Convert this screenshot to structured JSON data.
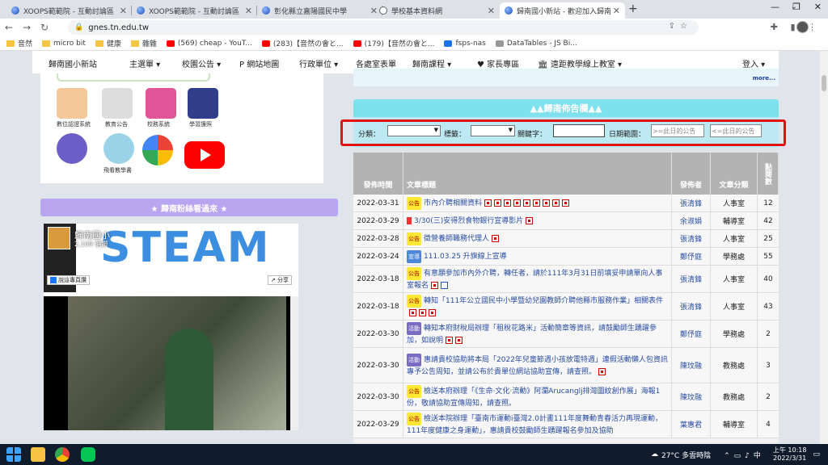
{
  "browser": {
    "tabs": [
      {
        "label": "XOOPS範範院 - 互動討論區",
        "active": false
      },
      {
        "label": "XOOPS範範院 - 互動討論區",
        "active": false
      },
      {
        "label": "彰化縣立嘉陽國民中學",
        "active": false
      },
      {
        "label": "學校基本資料網",
        "active": false
      },
      {
        "label": "歸南國小新站 - 歡迎加入歸南大家庭",
        "active": true
      }
    ],
    "url": "gnes.tn.edu.tw",
    "bookmarks": [
      {
        "label": "音然",
        "icon": "folder"
      },
      {
        "label": "micro bit",
        "icon": "folder"
      },
      {
        "label": "健康",
        "icon": "folder"
      },
      {
        "label": "雜雜",
        "icon": "folder"
      },
      {
        "label": "(569) cheap - YouT...",
        "icon": "yt"
      },
      {
        "label": "(283)【音然の會と...",
        "icon": "yt"
      },
      {
        "label": "(179)【音然の會と...",
        "icon": "yt"
      },
      {
        "label": "fsps-nas",
        "icon": "blue"
      },
      {
        "label": "DataTables - JS Bi...",
        "icon": "gray"
      }
    ]
  },
  "nav": {
    "site": "歸南國小新站",
    "items": [
      "主選單 ▾",
      "校園公告 ▾",
      "網站地圖",
      "行政單位 ▾",
      "各處室表單",
      "歸南課程 ▾",
      "家長專區",
      "遠距教學線上教室 ▾"
    ],
    "login": "登入 ▾"
  },
  "apps": [
    "數位認證系統",
    "教育公告",
    "校務系統",
    "學習護照",
    "飛看教學書"
  ],
  "fans": {
    "heading": "★ 歸南粉絲看過來 ★",
    "page_name": "歸南國小",
    "likes": "2,109 個讚",
    "like_btn": "說這專頁讚",
    "share_btn": "分享",
    "banner": "STEAM"
  },
  "announce": {
    "more": "more...",
    "heading": "▲▲歸南佈告欄▲▲",
    "filter": {
      "category_label": "分類：",
      "tag_label": "標籤：",
      "keyword_label": "關鍵字：",
      "date_label": "日期範圍：",
      "date_from_placeholder": ">=此日的公告",
      "date_to_placeholder": "<=此日的公告"
    },
    "columns": [
      "發佈時間",
      "文章標題",
      "發佈者",
      "文章分類",
      "點閱數"
    ],
    "rows": [
      {
        "date": "2022-03-31",
        "badge": "公告",
        "title": "市內介聘相關資料",
        "author": "張清鋒",
        "category": "人事室",
        "hits": "12"
      },
      {
        "date": "2022-03-29",
        "badge": "",
        "title": "3/30(三)安得烈食物銀行宣導影片",
        "author": "余淑娟",
        "category": "輔導室",
        "hits": "42"
      },
      {
        "date": "2022-03-28",
        "badge": "公告",
        "title": "徵營養師職務代理人",
        "author": "張清鋒",
        "category": "人事室",
        "hits": "25"
      },
      {
        "date": "2022-03-24",
        "badge": "宣導",
        "title": "111.03.25 升旗線上宣導",
        "author": "鄭伃庭",
        "category": "學務處",
        "hits": "55"
      },
      {
        "date": "2022-03-18",
        "badge": "公告",
        "title": "有意願參加市內外介聘，轉任者，請於111年3月31日前填妥申請單向人事室報名",
        "author": "張清鋒",
        "category": "人事室",
        "hits": "40"
      },
      {
        "date": "2022-03-18",
        "badge": "公告",
        "title": "轉知「111年公立國民中小學暨幼兒園教師介聘他縣市服務作業」相關表件",
        "author": "張清鋒",
        "category": "人事室",
        "hits": "43"
      },
      {
        "date": "2022-03-30",
        "badge": "活動",
        "title": "轉知本府財稅局辦理「租稅花路米」活動簡章等資訊，請鼓勵師生踴躍參加，如說明",
        "author": "鄭伃庭",
        "category": "學務處",
        "hits": "2"
      },
      {
        "date": "2022-03-30",
        "badge": "活動",
        "title": "惠請貴校協助將本局「2022年兒童節週小孩放電特週」連假活動懶人包資訊專予公告周知，並請公布於貴單位網站協助宣傳，請查照。",
        "author": "陳玟融",
        "category": "教務處",
        "hits": "3"
      },
      {
        "date": "2022-03-30",
        "badge": "公告",
        "title": "檢送本府辦理「《生命·文化·流動》阿瀾Arucanglj排灣圖紋創作展」海報1份，敬請協助宣傳周知，請查照。",
        "author": "陳玟融",
        "category": "教務處",
        "hits": "2"
      },
      {
        "date": "2022-03-29",
        "badge": "公告",
        "title": "檢送本院辦理「臺南市運動i臺灣2.0計畫111年度舞動青春活力再現運動，111年度健康之身運動」，惠請貴校鼓勵師生踴躍報名參加及協助",
        "author": "葉惠君",
        "category": "輔導室",
        "hits": "4"
      }
    ]
  },
  "taskbar": {
    "weather": "27°C 多雲時陰",
    "time": "上午 10:18",
    "date": "2022/3/31"
  }
}
